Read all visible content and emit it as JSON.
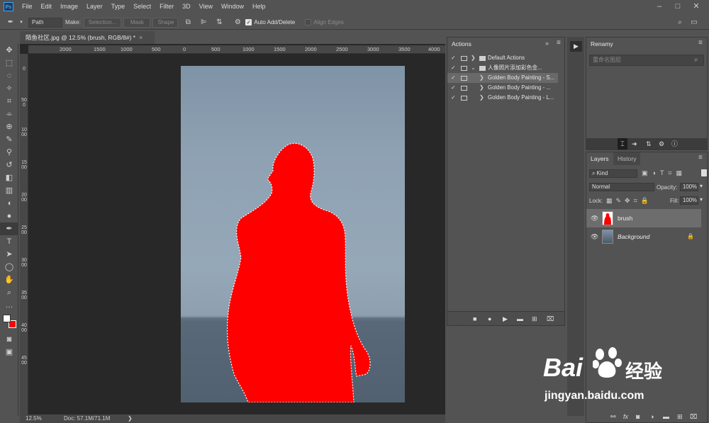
{
  "menubar": {
    "logo": "Ps",
    "items": [
      "File",
      "Edit",
      "Image",
      "Layer",
      "Type",
      "Select",
      "Filter",
      "3D",
      "View",
      "Window",
      "Help"
    ],
    "window_controls": [
      "–",
      "□",
      "✕"
    ]
  },
  "options_bar": {
    "mode": "Path",
    "make_label": "Make:",
    "selection_btn": "Selection...",
    "mask_btn": "Mask",
    "shape_btn": "Shape",
    "auto_add_delete": "Auto Add/Delete",
    "align_edges": "Align Edges"
  },
  "document": {
    "tab_title": "陌鱼社区.jpg @ 12.5% (brush, RGB/8#) *",
    "close": "×",
    "h_ruler": [
      "2000",
      "1500",
      "1000",
      "500",
      "0",
      "500",
      "1000",
      "1500",
      "2000",
      "2500",
      "3000",
      "3500",
      "4000"
    ],
    "v_ruler": [
      "0",
      "500",
      "1000",
      "1500",
      "2000",
      "2500",
      "3000",
      "3500",
      "4000",
      "4500"
    ],
    "zoom": "12.5%",
    "doc_size": "Doc: 57.1M/71.1M",
    "status_arrow": "❯"
  },
  "actions_panel": {
    "tab": "Actions",
    "rows": [
      {
        "label": "Default Actions",
        "selected": false,
        "arrow": "❯",
        "folder": true
      },
      {
        "label": "人像照片添加彩色金...",
        "selected": false,
        "arrow": "⌄",
        "folder": true
      },
      {
        "label": "Golden Body Painting - S...",
        "selected": true,
        "arrow": "❯",
        "folder": false
      },
      {
        "label": "Golden Body Painting - ...",
        "selected": false,
        "arrow": "❯",
        "folder": false
      },
      {
        "label": "Golden Body Painting - L...",
        "selected": false,
        "arrow": "❯",
        "folder": false
      }
    ],
    "footer_icons": [
      "stop-icon",
      "record-icon",
      "play-icon",
      "folder-icon",
      "new-action-icon",
      "trash-icon"
    ]
  },
  "renamy_panel": {
    "tab": "Renamy",
    "placeholder": "重命名图层"
  },
  "layers_panel": {
    "tabs": [
      "Layers",
      "History"
    ],
    "kind": "Kind",
    "blend_mode": "Normal",
    "opacity_label": "Opacity:",
    "opacity": "100%",
    "lock_label": "Lock:",
    "fill_label": "Fill:",
    "fill": "100%",
    "layers": [
      {
        "name": "brush",
        "selected": true
      },
      {
        "name": "Background",
        "selected": false,
        "locked": true
      }
    ],
    "footer_icons": [
      "link-icon",
      "fx-icon",
      "mask-icon",
      "adjustment-icon",
      "group-icon",
      "new-layer-icon",
      "trash-icon"
    ],
    "footer_fx": "fx"
  },
  "watermark": {
    "brand": "Bai",
    "brand2": "经验",
    "url": "jingyan.baidu.com"
  },
  "colors": {
    "selection_fill": "#ff0000",
    "ui_bg": "#535353",
    "canvas_bg": "#282828"
  }
}
